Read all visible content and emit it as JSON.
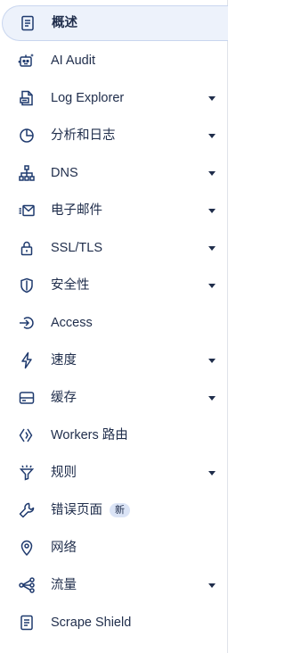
{
  "nav": {
    "items": [
      {
        "label": "概述",
        "icon": "document-icon",
        "active": true,
        "has_submenu": false
      },
      {
        "label": "AI Audit",
        "icon": "robot-icon",
        "active": false,
        "has_submenu": false
      },
      {
        "label": "Log Explorer",
        "icon": "log-file-icon",
        "active": false,
        "has_submenu": true
      },
      {
        "label": "分析和日志",
        "icon": "pie-chart-icon",
        "active": false,
        "has_submenu": true
      },
      {
        "label": "DNS",
        "icon": "network-tree-icon",
        "active": false,
        "has_submenu": true
      },
      {
        "label": "电子邮件",
        "icon": "email-icon",
        "active": false,
        "has_submenu": true
      },
      {
        "label": "SSL/TLS",
        "icon": "lock-icon",
        "active": false,
        "has_submenu": true
      },
      {
        "label": "安全性",
        "icon": "shield-icon",
        "active": false,
        "has_submenu": true
      },
      {
        "label": "Access",
        "icon": "access-icon",
        "active": false,
        "has_submenu": false
      },
      {
        "label": "速度",
        "icon": "bolt-icon",
        "active": false,
        "has_submenu": true
      },
      {
        "label": "缓存",
        "icon": "storage-icon",
        "active": false,
        "has_submenu": true
      },
      {
        "label": "Workers 路由",
        "icon": "workers-icon",
        "active": false,
        "has_submenu": false
      },
      {
        "label": "规则",
        "icon": "funnel-icon",
        "active": false,
        "has_submenu": true
      },
      {
        "label": "错误页面",
        "icon": "wrench-icon",
        "active": false,
        "has_submenu": false,
        "badge": "新"
      },
      {
        "label": "网络",
        "icon": "location-pin-icon",
        "active": false,
        "has_submenu": false
      },
      {
        "label": "流量",
        "icon": "traffic-share-icon",
        "active": false,
        "has_submenu": true
      },
      {
        "label": "Scrape Shield",
        "icon": "document-icon",
        "active": false,
        "has_submenu": false
      }
    ]
  },
  "colors": {
    "text": "#1f2d4b",
    "icon": "#1f3a6e",
    "active_background": "#edf2fb",
    "active_border": "#c9d6ef",
    "badge_background": "#dbe4f6"
  }
}
